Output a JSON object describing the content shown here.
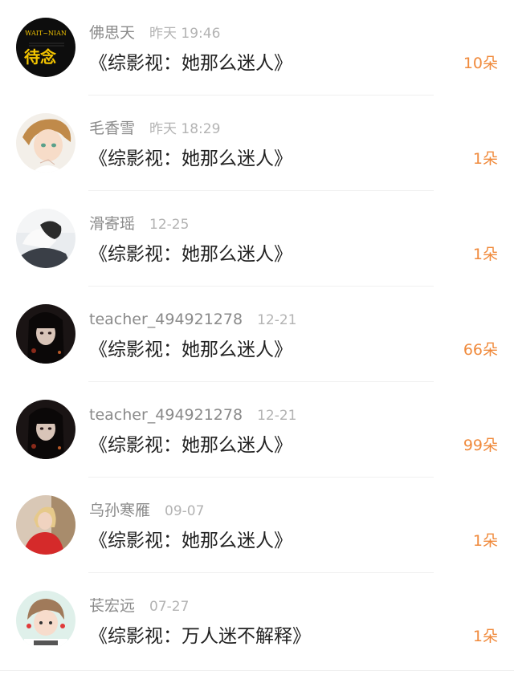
{
  "accent_color": "#f08a3c",
  "records": [
    {
      "name": "佛思天",
      "time": "昨天 19:46",
      "title": "《综影视：她那么迷人》",
      "gift": "10朵",
      "avatar": {
        "icon": "wait-nian-logo-avatar",
        "text": "待念",
        "logo_text": "WAIT~NIAN"
      }
    },
    {
      "name": "毛香雪",
      "time": "昨天 18:29",
      "title": "《综影视：她那么迷人》",
      "gift": "1朵",
      "avatar": {
        "icon": "anime-boy-avatar"
      }
    },
    {
      "name": "滑寄瑶",
      "time": "12-25",
      "title": "《综影视：她那么迷人》",
      "gift": "1朵",
      "avatar": {
        "icon": "photo-person-avatar"
      }
    },
    {
      "name": "teacher_494921278",
      "time": "12-21",
      "title": "《综影视：她那么迷人》",
      "gift": "66朵",
      "avatar": {
        "icon": "dark-girl-avatar"
      }
    },
    {
      "name": "teacher_494921278",
      "time": "12-21",
      "title": "《综影视：她那么迷人》",
      "gift": "99朵",
      "avatar": {
        "icon": "dark-girl-avatar"
      }
    },
    {
      "name": "乌孙寒雁",
      "time": "09-07",
      "title": "《综影视：她那么迷人》",
      "gift": "1朵",
      "avatar": {
        "icon": "red-dress-avatar"
      }
    },
    {
      "name": "苌宏远",
      "time": "07-27",
      "title": "《综影视：万人迷不解释》",
      "gift": "1朵",
      "avatar": {
        "icon": "cartoon-kid-avatar"
      }
    }
  ]
}
